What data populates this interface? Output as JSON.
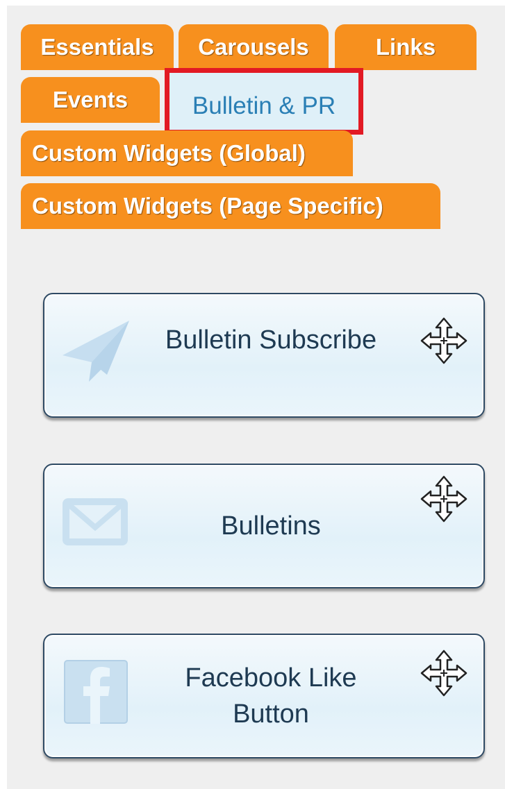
{
  "tabs": [
    {
      "label": "Essentials"
    },
    {
      "label": "Carousels"
    },
    {
      "label": "Links"
    },
    {
      "label": "Events"
    },
    {
      "label": "Bulletin & PR"
    },
    {
      "label": "Custom Widgets (Global)"
    },
    {
      "label": "Custom Widgets (Page Specific)"
    }
  ],
  "widgets": [
    {
      "label": "Bulletin Subscribe",
      "icon": "paper-plane-icon"
    },
    {
      "label": "Bulletins",
      "icon": "envelope-icon"
    },
    {
      "label_line1": "Facebook Like",
      "label_line2": "Button",
      "icon": "facebook-icon"
    }
  ],
  "colors": {
    "tab_orange": "#f7901e",
    "active_tab_bg": "#dff0f8",
    "active_tab_text": "#2a7fb5",
    "highlight_red": "#e21a24",
    "widget_text": "#1e3a52"
  }
}
